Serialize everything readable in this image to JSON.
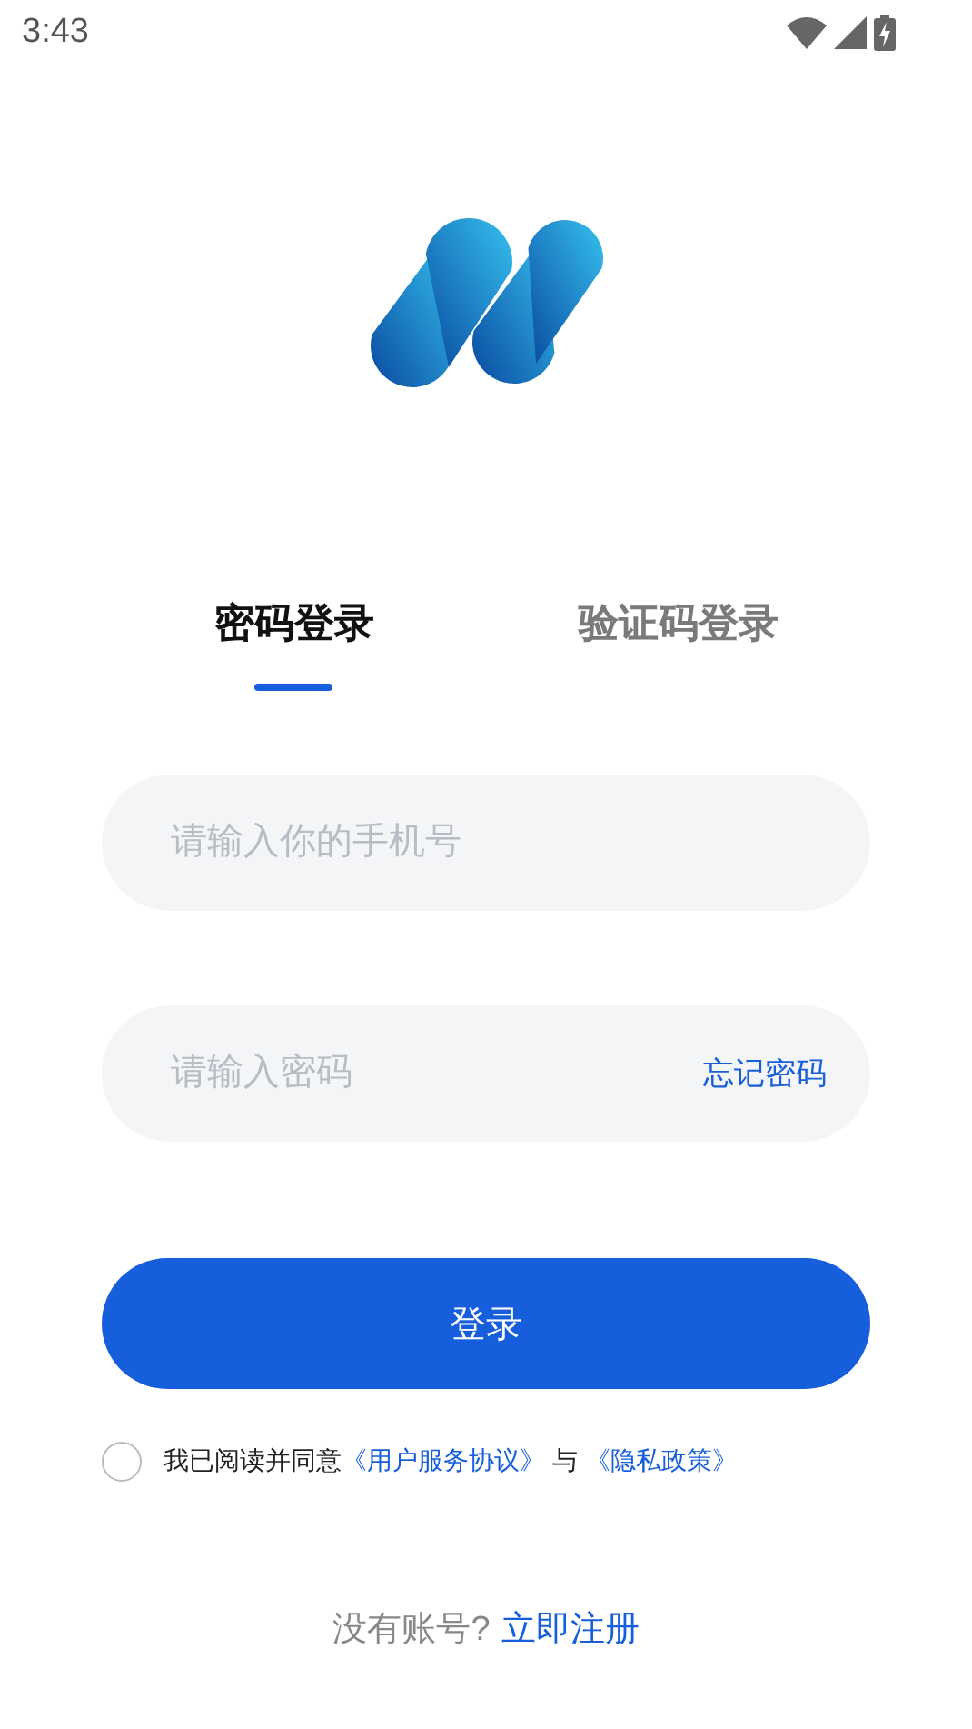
{
  "status_bar": {
    "time": "3:43"
  },
  "tabs": [
    {
      "label": "密码登录",
      "selected": true
    },
    {
      "label": "验证码登录",
      "selected": false
    }
  ],
  "phone_field": {
    "placeholder": "请输入你的手机号"
  },
  "password_field": {
    "placeholder": "请输入密码",
    "link": "忘记密码"
  },
  "login_button": "登录",
  "agreement": {
    "checked": false,
    "text": "我已阅读并同意",
    "link_1": "《用户服务协议》",
    "joiner": "与",
    "link_2": "《隐私政策》"
  },
  "register": {
    "prompt": "没有账号?",
    "link": "立即注册"
  }
}
